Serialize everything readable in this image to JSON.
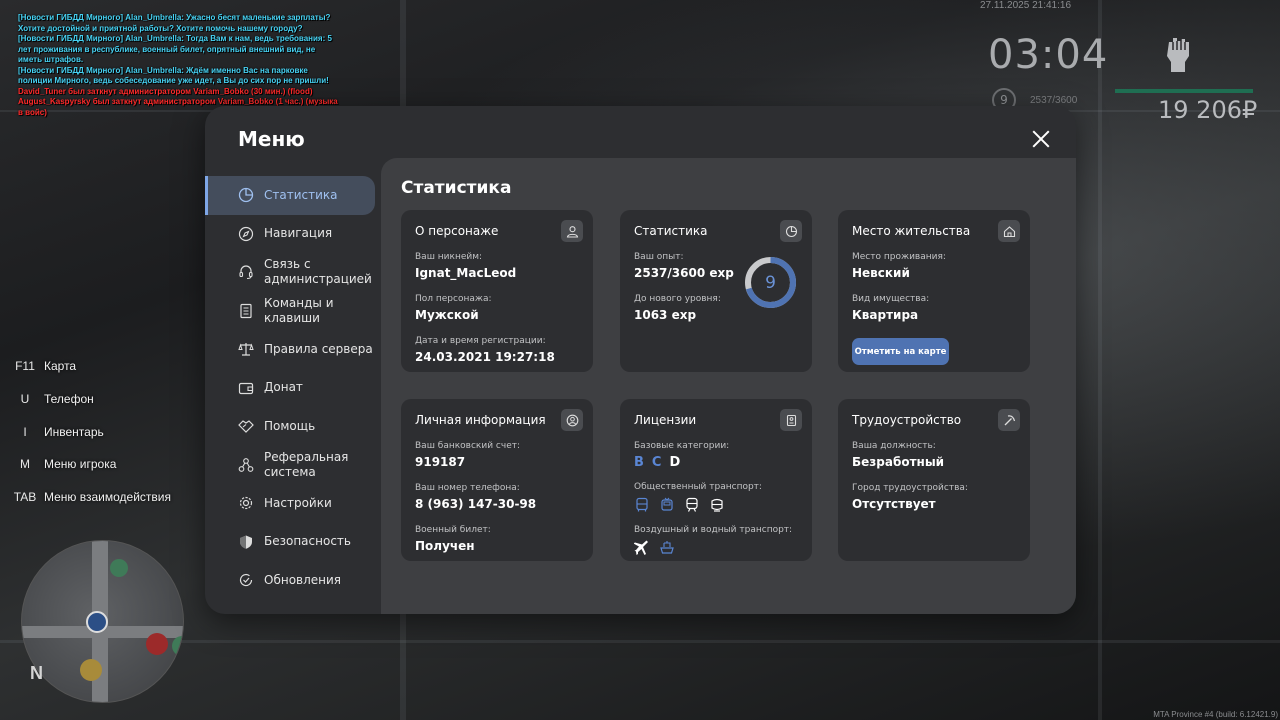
{
  "chat": [
    {
      "type": "news",
      "text": "[Новости ГИБДД Мирного] Alan_Umbrella: Ужасно бесят маленькие зарплаты? Хотите достойной и приятной работы? Хотите помочь нашему городу?"
    },
    {
      "type": "news",
      "text": "[Новости ГИБДД Мирного] Alan_Umbrella: Тогда Вам к нам, ведь требования: 5 лет проживания в республике, военный билет, опрятный внешний вид, не иметь штрафов."
    },
    {
      "type": "news",
      "text": "[Новости ГИБДД Мирного] Alan_Umbrella: Ждём именно Вас на парковке полиции Мирного, ведь собеседование уже идет, а Вы до сих пор не пришли!"
    },
    {
      "type": "admin",
      "text": "David_Tuner был заткнут администратором Variam_Bobko (30 мин.) (flood)"
    },
    {
      "type": "admin",
      "text": "August_Kaspyrsky был заткнут администратором Variam_Bobko (1 час.) (музыка в войс)"
    }
  ],
  "hud": {
    "datetime": "27.11.2025 21:41:16",
    "clock": "03:04",
    "level": "9",
    "exp": "2537/3600",
    "money": "19 206₽",
    "health_color": "#1f6e52"
  },
  "keys": [
    {
      "key": "F11",
      "label": "Карта"
    },
    {
      "key": "U",
      "label": "Телефон"
    },
    {
      "key": "I",
      "label": "Инвентарь"
    },
    {
      "key": "M",
      "label": "Меню игрока"
    },
    {
      "key": "TAB",
      "label": "Меню взаимодействия"
    }
  ],
  "minimap": {
    "north": "N"
  },
  "build": "MTA Province #4 (build: 6.12421.9)",
  "menu": {
    "title": "Меню",
    "accent": "#7ea6e6",
    "sidebar": [
      {
        "label": "Статистика",
        "icon": "pie-chart-icon",
        "active": true
      },
      {
        "label": "Навигация",
        "icon": "compass-icon"
      },
      {
        "label": "Связь с администрацией",
        "icon": "headset-icon"
      },
      {
        "label": "Команды и клавиши",
        "icon": "document-icon"
      },
      {
        "label": "Правила сервера",
        "icon": "scales-icon"
      },
      {
        "label": "Донат",
        "icon": "wallet-icon"
      },
      {
        "label": "Помощь",
        "icon": "handshake-icon"
      },
      {
        "label": "Реферальная система",
        "icon": "network-icon"
      },
      {
        "label": "Настройки",
        "icon": "gear-icon"
      },
      {
        "label": "Безопасность",
        "icon": "shield-icon"
      },
      {
        "label": "Обновления",
        "icon": "refresh-check-icon"
      }
    ],
    "content_title": "Статистика",
    "cards": {
      "character": {
        "title": "О персонаже",
        "nickname_label": "Ваш никнейм:",
        "nickname": "Ignat_MacLeod",
        "gender_label": "Пол персонажа:",
        "gender": "Мужской",
        "reg_label": "Дата и время регистрации:",
        "reg": "24.03.2021 19:27:18"
      },
      "stats": {
        "title": "Статистика",
        "exp_label": "Ваш опыт:",
        "exp": "2537/3600 exp",
        "next_label": "До нового уровня:",
        "next": "1063 exp",
        "level": "9",
        "exp_fraction": 0.705
      },
      "residence": {
        "title": "Место жительства",
        "place_label": "Место проживания:",
        "place": "Невский",
        "property_label": "Вид имущества:",
        "property": "Квартира",
        "button": "Отметить на карте"
      },
      "personal": {
        "title": "Личная информация",
        "bank_label": "Ваш банковский счет:",
        "bank": "919187",
        "phone_label": "Ваш номер телефона:",
        "phone": "8 (963) 147-30-98",
        "military_label": "Военный билет:",
        "military": "Получен"
      },
      "licenses": {
        "title": "Лицензии",
        "base_label": "Базовые категории:",
        "categories": [
          {
            "name": "B",
            "owned": false
          },
          {
            "name": "C",
            "owned": false
          },
          {
            "name": "D",
            "owned": true
          }
        ],
        "public_label": "Общественный транспорт:",
        "air_label": "Воздушный и водный транспорт:"
      },
      "employment": {
        "title": "Трудоустройство",
        "position_label": "Ваша должность:",
        "position": "Безработный",
        "city_label": "Город трудоустройства:",
        "city": "Отсутствует"
      }
    }
  }
}
